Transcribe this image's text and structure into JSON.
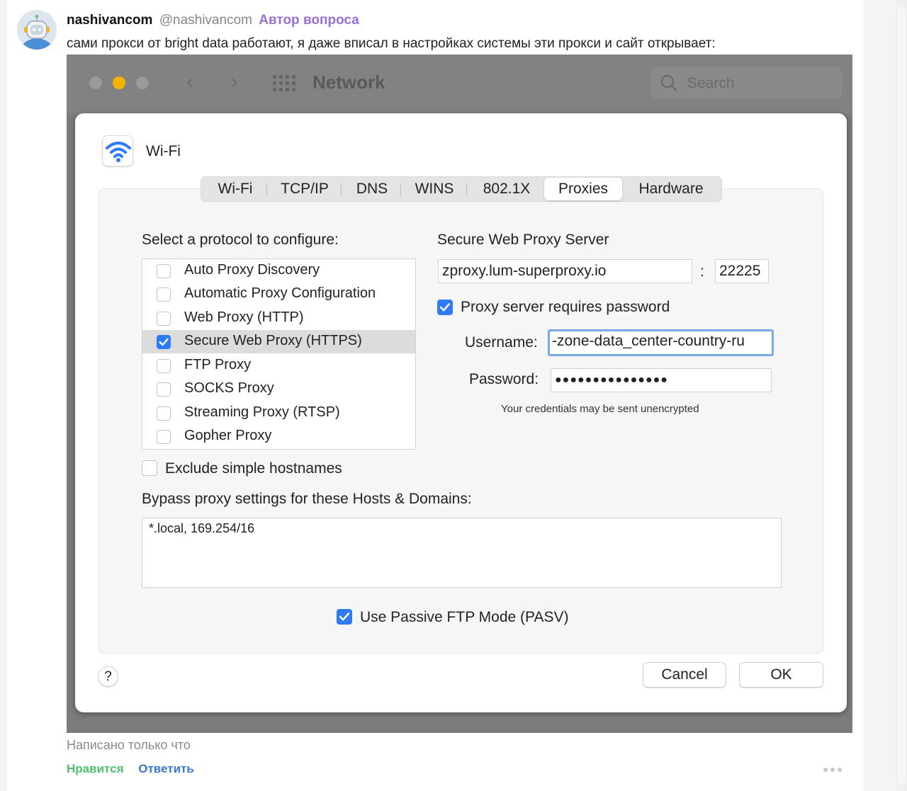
{
  "post": {
    "author_name": "nashivancom",
    "author_handle": "@nashivancom",
    "author_badge": "Автор вопроса",
    "text": "сами прокси от bright data работают, я даже вписал в настройках системы эти прокси и сайт открывает:",
    "time": "Написано только что",
    "like_label": "Нравится",
    "reply_label": "Ответить"
  },
  "window": {
    "title": "Network",
    "search_placeholder": "Search",
    "traffic_colors": [
      "#9a9a9a",
      "#f5b400",
      "#9a9a9a"
    ]
  },
  "dialog": {
    "interface_name": "Wi-Fi",
    "tabs": [
      "Wi-Fi",
      "TCP/IP",
      "DNS",
      "WINS",
      "802.1X",
      "Proxies",
      "Hardware"
    ],
    "active_tab": "Proxies",
    "protocol_heading": "Select a protocol to configure:",
    "protocols": [
      {
        "label": "Auto Proxy Discovery",
        "checked": false
      },
      {
        "label": "Automatic Proxy Configuration",
        "checked": false
      },
      {
        "label": "Web Proxy (HTTP)",
        "checked": false
      },
      {
        "label": "Secure Web Proxy (HTTPS)",
        "checked": true
      },
      {
        "label": "FTP Proxy",
        "checked": false
      },
      {
        "label": "SOCKS Proxy",
        "checked": false
      },
      {
        "label": "Streaming Proxy (RTSP)",
        "checked": false
      },
      {
        "label": "Gopher Proxy",
        "checked": false
      }
    ],
    "server_heading": "Secure Web Proxy Server",
    "server_host": "zproxy.lum-superproxy.io",
    "port_separator": ":",
    "server_port": "22225",
    "requires_password_label": "Proxy server requires password",
    "requires_password": true,
    "username_label": "Username:",
    "username_value": "-zone-data_center-country-ru",
    "password_label": "Password:",
    "password_value": "●●●●●●●●●●●●●●●",
    "credentials_note": "Your credentials may be sent unencrypted",
    "exclude_simple_label": "Exclude simple hostnames",
    "exclude_simple": false,
    "bypass_heading": "Bypass proxy settings for these Hosts & Domains:",
    "bypass_value": "*.local, 169.254/16",
    "passive_ftp_label": "Use Passive FTP Mode (PASV)",
    "passive_ftp": true,
    "help_label": "?",
    "cancel_label": "Cancel",
    "ok_label": "OK"
  },
  "colors": {
    "accent": "#2f7bf5",
    "badge": "#9b6ed6",
    "like": "#4fbe6f",
    "reply": "#3a78c8"
  }
}
